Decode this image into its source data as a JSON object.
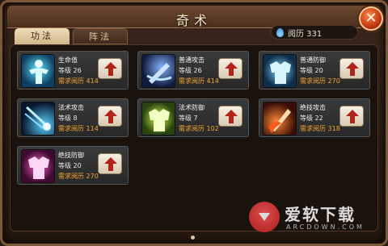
{
  "window": {
    "title": "奇术"
  },
  "tabs": [
    {
      "label": "功法",
      "active": true
    },
    {
      "label": "阵法",
      "active": false
    }
  ],
  "currency": {
    "icon": "water-drop-icon",
    "label": "阅历 331"
  },
  "skills": [
    {
      "name": "生命值",
      "level": "等级 26",
      "req": "需求阅历 414",
      "icon": "muscle-body-icon",
      "colors": [
        "#5fe6ff",
        "#0f3f63"
      ]
    },
    {
      "name": "普通攻击",
      "level": "等级 26",
      "req": "需求阅历 414",
      "icon": "blue-strike-icon",
      "colors": [
        "#86b6ff",
        "#101b3f"
      ]
    },
    {
      "name": "普通防御",
      "level": "等级 20",
      "req": "需求阅历 270",
      "icon": "blue-armor-icon",
      "colors": [
        "#7fd8ff",
        "#0e2f4c"
      ]
    },
    {
      "name": "法术攻击",
      "level": "等级 8",
      "req": "需求阅历 114",
      "icon": "comet-icon",
      "colors": [
        "#5ad0ff",
        "#07172e"
      ]
    },
    {
      "name": "法术防御",
      "level": "等级 7",
      "req": "需求阅历 102",
      "icon": "green-armor-icon",
      "colors": [
        "#cfff4a",
        "#2a4410"
      ]
    },
    {
      "name": "绝技攻击",
      "level": "等级 22",
      "req": "需求阅历 318",
      "icon": "fire-blade-icon",
      "colors": [
        "#ff8a3a",
        "#3a0e06"
      ]
    },
    {
      "name": "绝技防御",
      "level": "等级 20",
      "req": "需求阅历 270",
      "icon": "pink-armor-icon",
      "colors": [
        "#ff5fd2",
        "#3e0b2e"
      ]
    }
  ],
  "watermark": {
    "text": "爱软下载",
    "sub": "ARCDOWN.COM"
  }
}
